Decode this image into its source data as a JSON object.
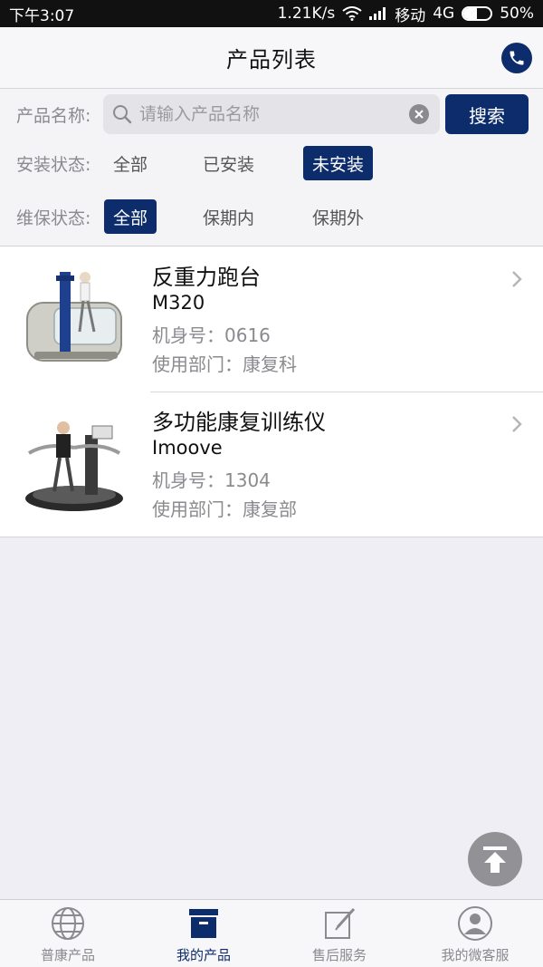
{
  "status_bar": {
    "time": "下午3:07",
    "speed": "1.21K/s",
    "carrier": "移动",
    "network": "4G",
    "battery": "50%",
    "battery_level": 0.5
  },
  "header": {
    "title": "产品列表"
  },
  "filters": {
    "name_label": "产品名称:",
    "search_placeholder": "请输入产品名称",
    "search_value": "",
    "search_button": "搜索",
    "install_label": "安装状态:",
    "install_options": [
      "全部",
      "已安装",
      "未安装"
    ],
    "install_selected": "未安装",
    "warranty_label": "维保状态:",
    "warranty_options": [
      "全部",
      "保期内",
      "保期外"
    ],
    "warranty_selected": "全部"
  },
  "products": [
    {
      "name": "反重力跑台",
      "model": "M320",
      "serial": "机身号：0616",
      "department": "使用部门：康复科"
    },
    {
      "name": "多功能康复训练仪",
      "model": "Imoove",
      "serial": "机身号：1304",
      "department": "使用部门：康复部"
    }
  ],
  "tabbar": {
    "items": [
      {
        "label": "普康产品",
        "icon": "globe-icon"
      },
      {
        "label": "我的产品",
        "icon": "box-icon"
      },
      {
        "label": "售后服务",
        "icon": "edit-icon"
      },
      {
        "label": "我的微客服",
        "icon": "user-icon"
      }
    ],
    "active_index": 1
  },
  "colors": {
    "brand": "#0c2c6b",
    "background": "#eeeef4"
  }
}
